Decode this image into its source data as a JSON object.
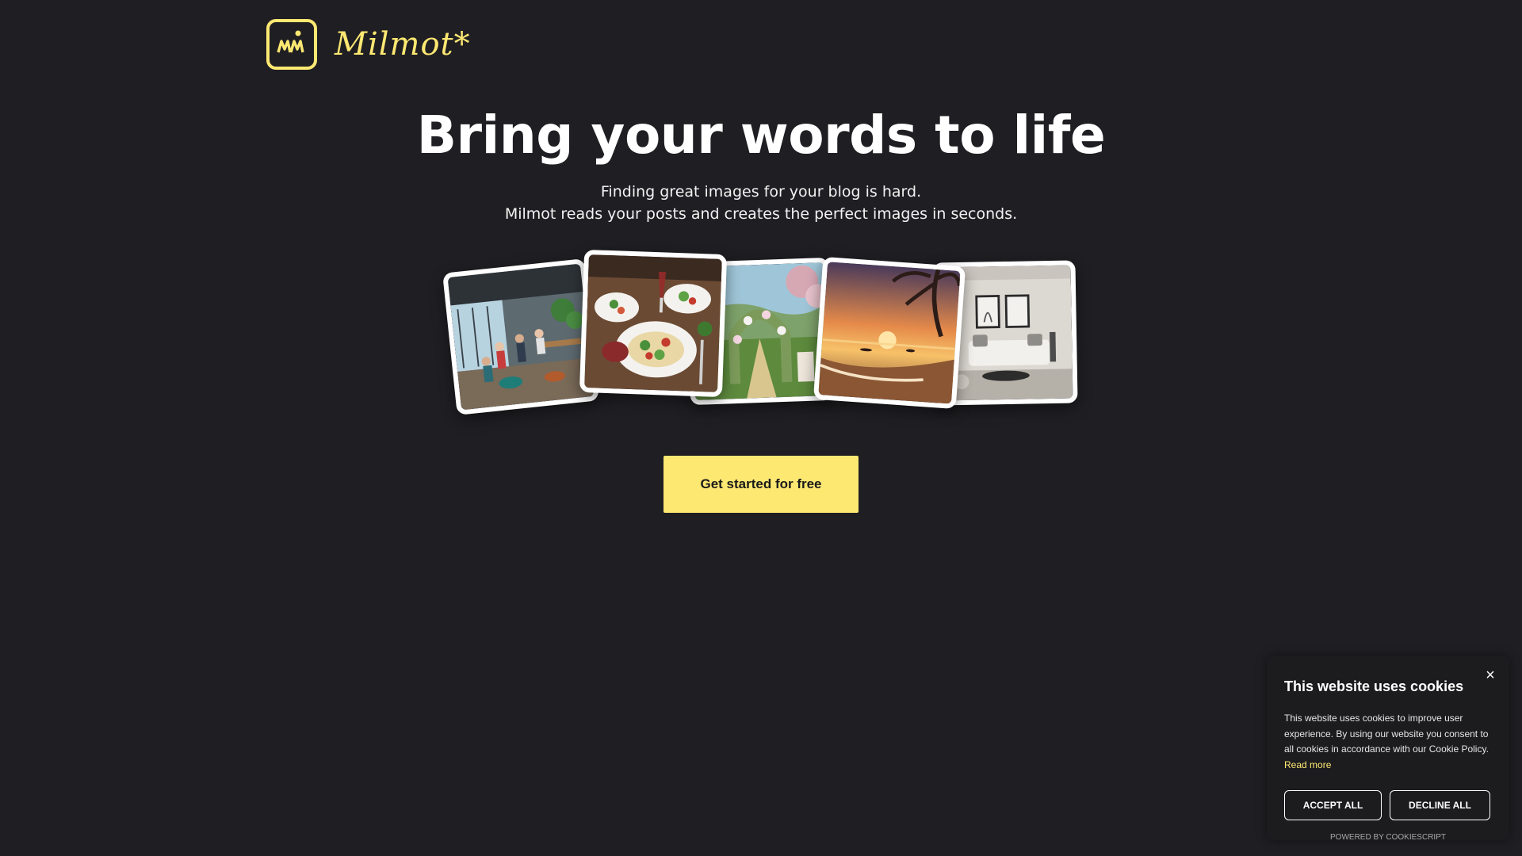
{
  "brand": {
    "name": "Milmot*",
    "logo_mark": "MM",
    "accent": "#fde872"
  },
  "hero": {
    "title": "Bring your words to life",
    "subtitle_line1": "Finding great images for your blog is hard.",
    "subtitle_line2": "Milmot reads your posts and creates the perfect images in seconds."
  },
  "gallery": {
    "images": [
      {
        "icon": "office-cafe-image"
      },
      {
        "icon": "food-table-image"
      },
      {
        "icon": "garden-arch-image"
      },
      {
        "icon": "sunset-beach-image"
      },
      {
        "icon": "living-room-image"
      }
    ]
  },
  "cta": {
    "label": "Get started for free"
  },
  "cookie": {
    "title": "This website uses cookies",
    "body": "This website uses cookies to improve user experience. By using our website you consent to all cookies in accordance with our Cookie Policy.",
    "read_more": "Read more",
    "accept": "ACCEPT ALL",
    "decline": "DECLINE ALL",
    "powered": "POWERED BY COOKIESCRIPT",
    "close_icon": "×"
  },
  "colors": {
    "background": "#1f1f23",
    "text": "#ffffff",
    "button": "#fde872"
  }
}
